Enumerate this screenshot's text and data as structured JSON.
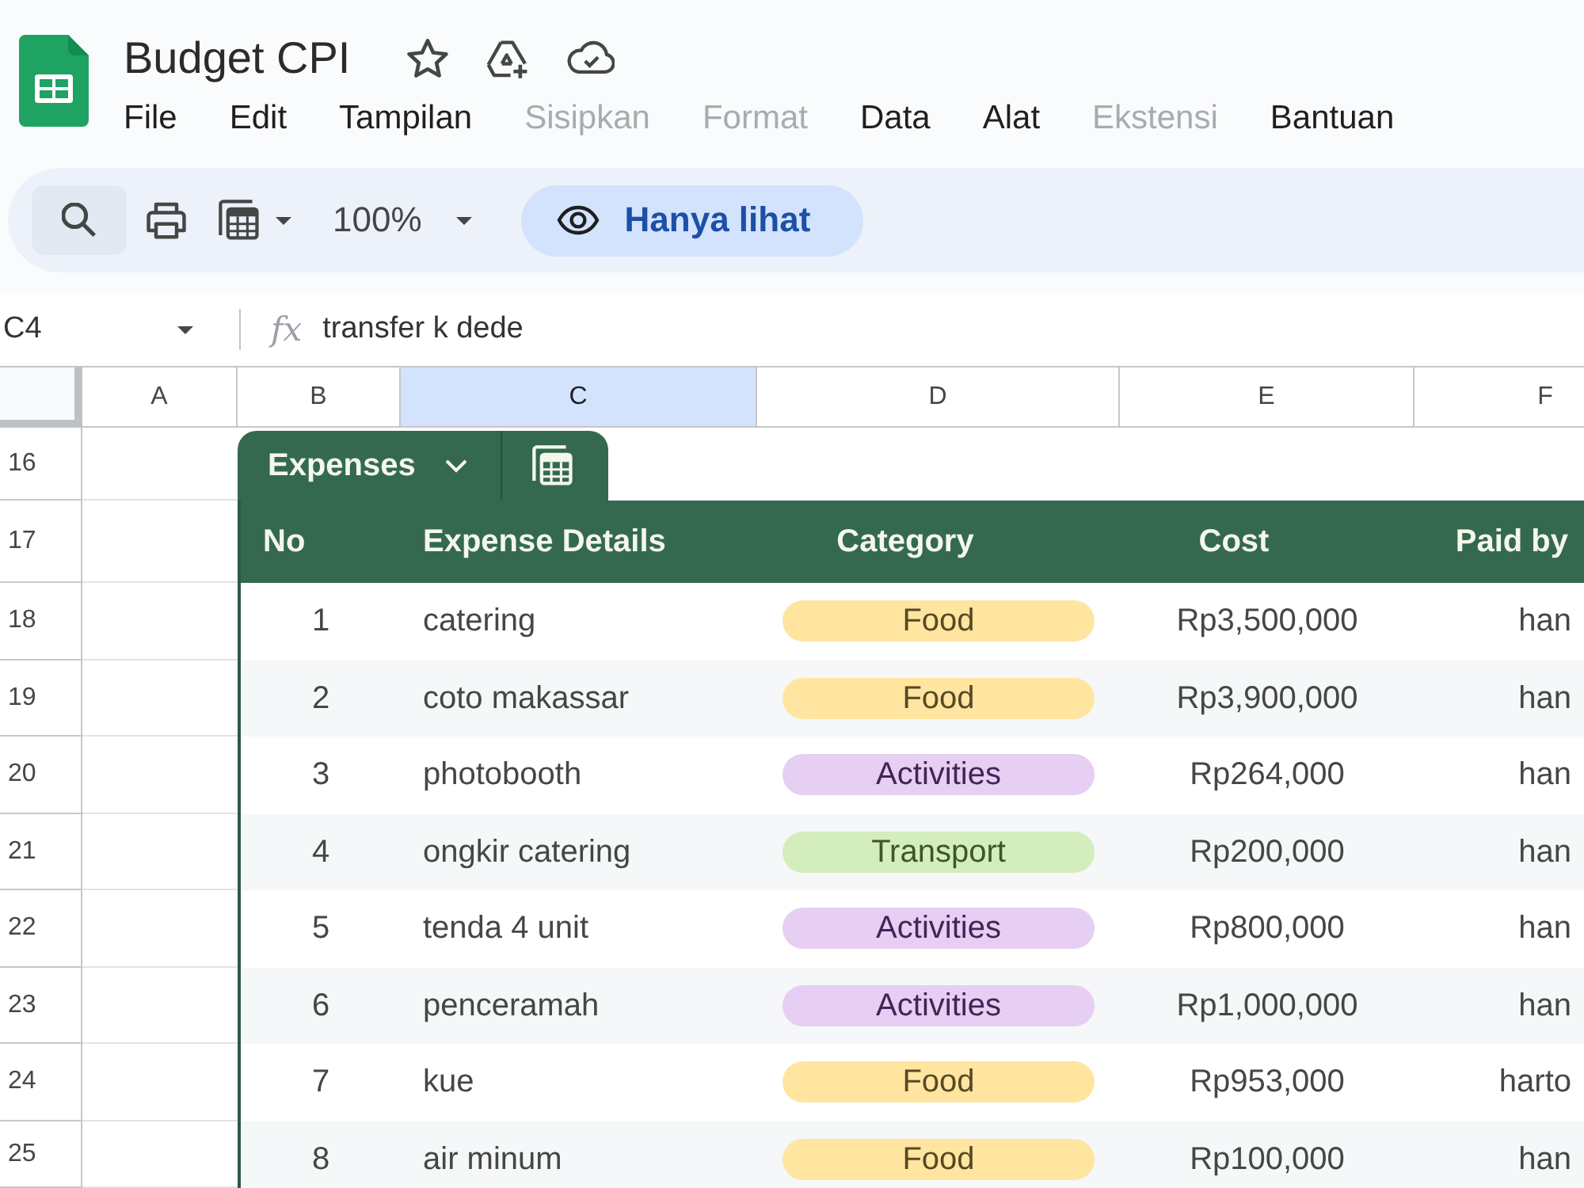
{
  "document": {
    "title": "Budget CPI"
  },
  "menu": [
    {
      "label": "File",
      "disabled": false
    },
    {
      "label": "Edit",
      "disabled": false
    },
    {
      "label": "Tampilan",
      "disabled": false
    },
    {
      "label": "Sisipkan",
      "disabled": true
    },
    {
      "label": "Format",
      "disabled": true
    },
    {
      "label": "Data",
      "disabled": false
    },
    {
      "label": "Alat",
      "disabled": false
    },
    {
      "label": "Ekstensi",
      "disabled": true
    },
    {
      "label": "Bantuan",
      "disabled": false
    }
  ],
  "toolbar": {
    "zoom": "100%",
    "mode_button": "Hanya lihat"
  },
  "formula_bar": {
    "cell_reference": "C4",
    "fx_symbol": "fx",
    "value": "transfer k dede"
  },
  "sheet": {
    "columns": [
      {
        "label": "A",
        "selected": false
      },
      {
        "label": "B",
        "selected": false
      },
      {
        "label": "C",
        "selected": true
      },
      {
        "label": "D",
        "selected": false
      },
      {
        "label": "E",
        "selected": false
      },
      {
        "label": "F",
        "selected": false
      }
    ],
    "rows": [
      {
        "label": "16",
        "selected": false
      },
      {
        "label": "17",
        "selected": false
      },
      {
        "label": "18",
        "selected": false
      },
      {
        "label": "19",
        "selected": false
      },
      {
        "label": "20",
        "selected": false
      },
      {
        "label": "21",
        "selected": false
      },
      {
        "label": "22",
        "selected": false
      },
      {
        "label": "23",
        "selected": false
      },
      {
        "label": "24",
        "selected": false
      },
      {
        "label": "25",
        "selected": false
      }
    ],
    "table": {
      "name": "Expenses",
      "columns": [
        "No",
        "Expense Details",
        "Category",
        "Cost",
        "Paid by"
      ],
      "rows": [
        {
          "no": "1",
          "details": "catering",
          "category": {
            "label": "Food",
            "color": "#ffe5a0"
          },
          "cost": "Rp3,500,000",
          "paid_by": "han"
        },
        {
          "no": "2",
          "details": "coto makassar",
          "category": {
            "label": "Food",
            "color": "#ffe5a0"
          },
          "cost": "Rp3,900,000",
          "paid_by": "han"
        },
        {
          "no": "3",
          "details": "photobooth",
          "category": {
            "label": "Activities",
            "color": "#e6cff2"
          },
          "cost": "Rp264,000",
          "paid_by": "han"
        },
        {
          "no": "4",
          "details": "ongkir catering",
          "category": {
            "label": "Transport",
            "color": "#d4edbc"
          },
          "cost": "Rp200,000",
          "paid_by": "han"
        },
        {
          "no": "5",
          "details": "tenda 4 unit",
          "category": {
            "label": "Activities",
            "color": "#e6cff2"
          },
          "cost": "Rp800,000",
          "paid_by": "han"
        },
        {
          "no": "6",
          "details": "penceramah",
          "category": {
            "label": "Activities",
            "color": "#e6cff2"
          },
          "cost": "Rp1,000,000",
          "paid_by": "han"
        },
        {
          "no": "7",
          "details": "kue",
          "category": {
            "label": "Food",
            "color": "#ffe5a0"
          },
          "cost": "Rp953,000",
          "paid_by": "harto"
        },
        {
          "no": "8",
          "details": "air minum",
          "category": {
            "label": "Food",
            "color": "#ffe5a0"
          },
          "cost": "Rp100,000",
          "paid_by": "han"
        }
      ]
    }
  }
}
